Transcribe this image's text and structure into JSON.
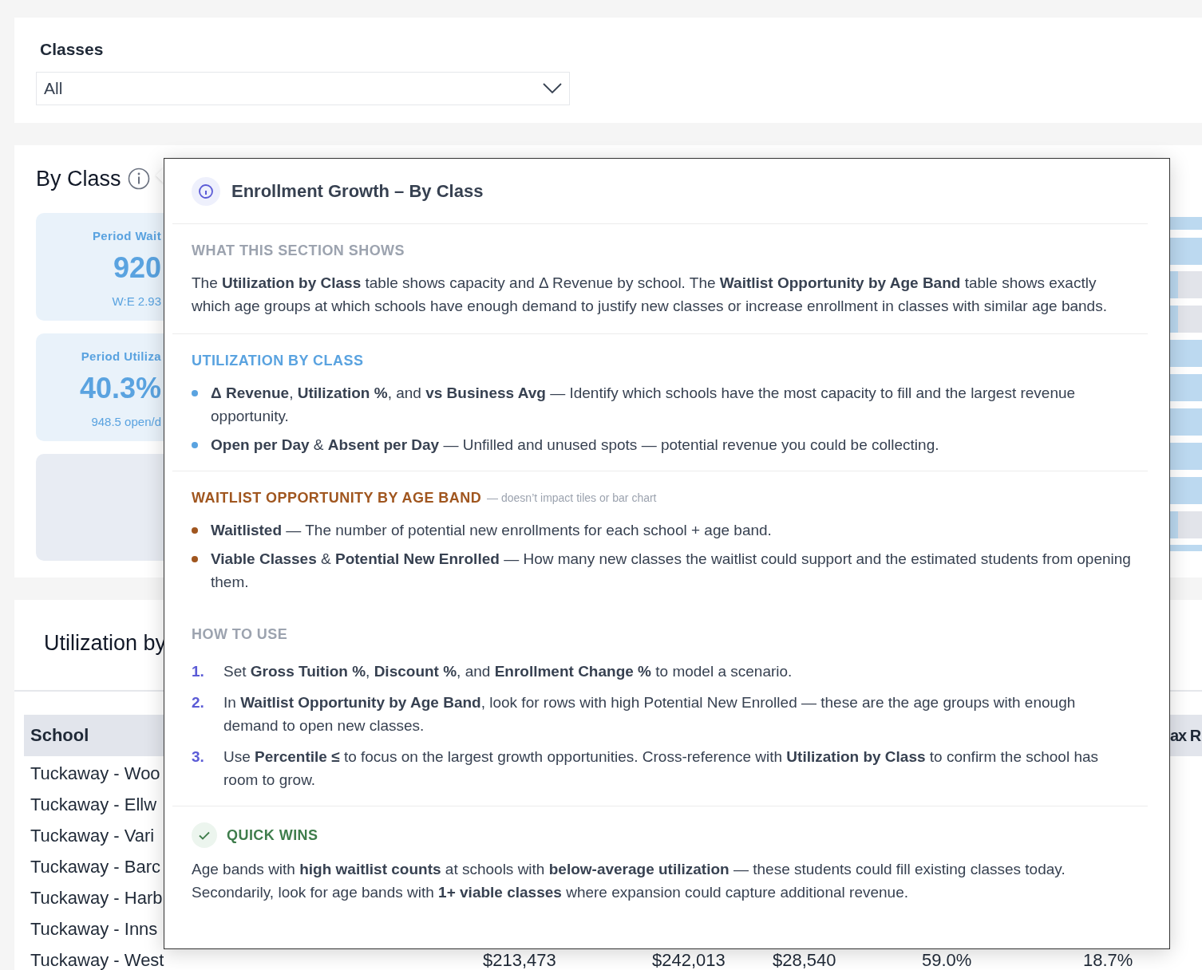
{
  "filter": {
    "label": "Classes",
    "value": "All"
  },
  "by_class": {
    "title": "By Class",
    "tiles": [
      {
        "kind": "metric",
        "label": "Period Wait",
        "value": "920",
        "sub": "W:E 2.93"
      },
      {
        "kind": "metric",
        "label": "Period Utiliza",
        "value": "40.3%",
        "sub": "948.5 open/d"
      },
      {
        "kind": "empty"
      }
    ]
  },
  "popover": {
    "title": "Enrollment Growth – By Class",
    "sections": [
      {
        "kind": "text",
        "heading": "WHAT THIS SECTION SHOWS",
        "color": "#9ca3af",
        "text": "The **Utilization by Class** table shows capacity and Δ Revenue by school. The **Waitlist Opportunity by Age Band** table shows exactly which age groups at which schools have enough demand to justify new classes or increase enrollment in classes with similar age bands."
      },
      {
        "kind": "bullets",
        "heading": "UTILIZATION BY CLASS",
        "color": "#5aa3e0",
        "divider": true,
        "items": [
          "**Δ Revenue**, **Utilization %**, and **vs Business Avg** — Identify which schools have the most capacity to fill and the largest revenue opportunity.",
          "**Open per Day** & **Absent per Day** — Unfilled and unused spots — potential revenue you could be collecting."
        ]
      },
      {
        "kind": "bullets",
        "heading": "WAITLIST OPPORTUNITY BY AGE BAND",
        "note": "— doesn’t impact tiles or bar chart",
        "color": "#a0561f",
        "divider": true,
        "items": [
          "**Waitlisted** — The number of potential new enrollments for each school + age band.",
          "**Viable Classes** & **Potential New Enrolled** — How many new classes the waitlist could support and the estimated students from opening them."
        ]
      },
      {
        "kind": "steps",
        "heading": "HOW TO USE",
        "color": "#9ca3af",
        "divider": false,
        "items": [
          {
            "number": "1.",
            "text": "Set **Gross Tuition %**, **Discount %**, and **Enrollment Change %** to model a scenario."
          },
          {
            "number": "2.",
            "text": "In **Waitlist Opportunity by Age Band**, look for rows with high Potential New Enrolled — these are the age groups with enough demand to open new classes."
          },
          {
            "number": "3.",
            "text": "Use **Percentile ≤** to focus on the largest growth opportunities. Cross-reference with **Utilization by Class** to confirm the school has room to grow."
          }
        ]
      },
      {
        "kind": "quick_wins",
        "heading": "QUICK WINS",
        "color": "#3f7d4c",
        "divider": true,
        "text": "Age bands with **high waitlist counts** at schools with **below-average utilization** — these students could fill existing classes today. Secondarily, look for age bands with **1+ viable classes** where expansion could capture additional revenue."
      }
    ]
  },
  "utilization": {
    "title": "Utilization by",
    "columns": [
      "School",
      "ax R"
    ],
    "rows": [
      {
        "cells": [
          "Tuckaway - Woo"
        ]
      },
      {
        "cells": [
          "Tuckaway - Ellw"
        ]
      },
      {
        "cells": [
          "Tuckaway - Vari"
        ]
      },
      {
        "cells": [
          "Tuckaway - Barc"
        ]
      },
      {
        "cells": [
          "Tuckaway - Harb"
        ]
      },
      {
        "cells": [
          "Tuckaway - Inns"
        ]
      },
      {
        "cells": [
          "Tuckaway - West",
          "$213,473",
          "$242,013",
          "$28,540",
          "59.0%",
          "18.7%"
        ]
      }
    ]
  }
}
